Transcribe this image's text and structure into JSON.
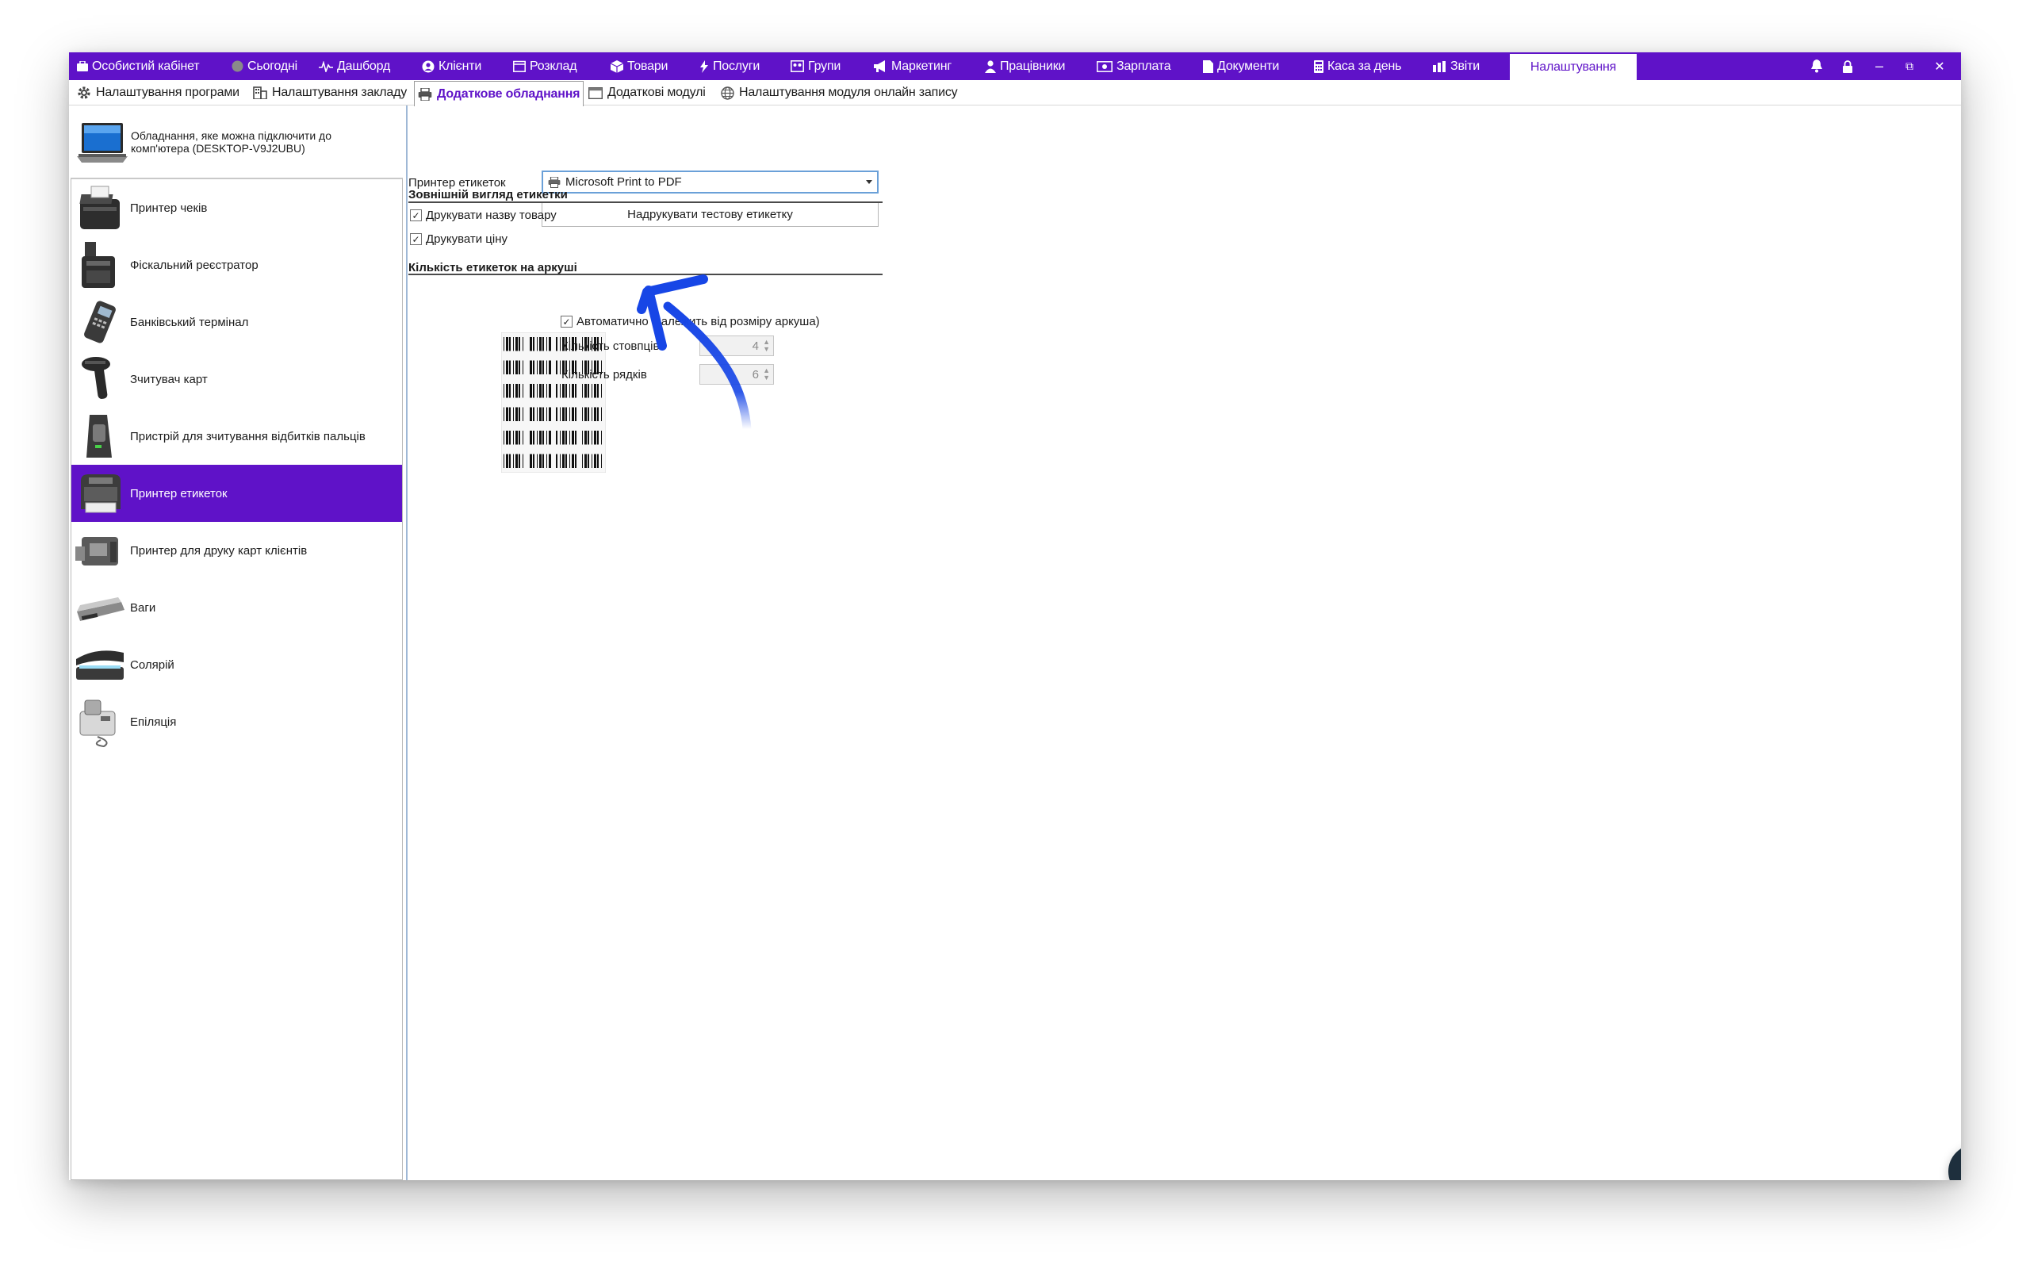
{
  "menu": {
    "items": [
      {
        "label": "Особистий кабінет",
        "icon": "briefcase-icon"
      },
      {
        "label": "Сьогодні",
        "icon": "clock-icon"
      },
      {
        "label": "Дашборд",
        "icon": "pulse-icon"
      },
      {
        "label": "Клієнти",
        "icon": "user-circle-icon"
      },
      {
        "label": "Розклад",
        "icon": "calendar-icon"
      },
      {
        "label": "Товари",
        "icon": "box-icon"
      },
      {
        "label": "Послуги",
        "icon": "lightning-icon"
      },
      {
        "label": "Групи",
        "icon": "group-icon"
      },
      {
        "label": "Маркетинг",
        "icon": "megaphone-icon"
      },
      {
        "label": "Працівники",
        "icon": "person-icon"
      },
      {
        "label": "Зарплата",
        "icon": "money-icon"
      },
      {
        "label": "Документи",
        "icon": "document-icon"
      },
      {
        "label": "Каса за день",
        "icon": "calculator-icon"
      },
      {
        "label": "Звіти",
        "icon": "bar-chart-icon"
      }
    ],
    "active": "Налаштування"
  },
  "window_buttons": {
    "bell": "bell-icon",
    "lock": "lock-icon",
    "minimize": "–",
    "restore": "⧉",
    "close": "✕"
  },
  "subtabs": [
    {
      "label": "Налаштування програми",
      "icon": "gear-icon"
    },
    {
      "label": "Налаштування закладу",
      "icon": "building-icon"
    },
    {
      "label": "Додаткове обладнання",
      "icon": "printer-icon",
      "active": true
    },
    {
      "label": "Додаткові модулі",
      "icon": "window-icon"
    },
    {
      "label": "Налаштування модуля онлайн запису",
      "icon": "globe-icon"
    }
  ],
  "device_header": "Обладнання, яке можна підключити до комп'ютера (DESKTOP-V9J2UBU)",
  "devices": [
    {
      "label": "Принтер чеків",
      "icon": "receipt-printer-icon"
    },
    {
      "label": "Фіскальний реєстратор",
      "icon": "fiscal-register-icon"
    },
    {
      "label": "Банківський термінал",
      "icon": "bank-terminal-icon"
    },
    {
      "label": "Зчитувач карт",
      "icon": "card-reader-icon"
    },
    {
      "label": "Пристрій для зчитування відбитків пальців",
      "icon": "fingerprint-reader-icon"
    },
    {
      "label": "Принтер етикеток",
      "icon": "label-printer-icon",
      "selected": true
    },
    {
      "label": "Принтер для друку карт клієнтів",
      "icon": "card-printer-icon"
    },
    {
      "label": "Ваги",
      "icon": "scales-icon"
    },
    {
      "label": "Солярій",
      "icon": "solarium-icon"
    },
    {
      "label": "Епіляція",
      "icon": "epilation-icon"
    }
  ],
  "settings": {
    "printer_label": "Принтер етикеток",
    "printer_value": "Microsoft Print to PDF",
    "test_button": "Надрукувати тестову етикетку",
    "appearance_title": "Зовнішній вигляд етикетки",
    "print_name": {
      "label": "Друкувати назву товару",
      "checked": true
    },
    "print_price": {
      "label": "Друкувати ціну",
      "checked": true
    },
    "count_title": "Кількість етикеток на аркуші",
    "auto": {
      "label": "Автоматично (залежить від розміру аркуша)",
      "checked": true
    },
    "columns_label": "Кількість стовпців",
    "columns_value": "4",
    "rows_label": "Кількість рядків",
    "rows_value": "6"
  },
  "colors": {
    "accent": "#5f12c8",
    "annotation_arrow": "#1746e6",
    "chat_button": "#1e2f3d"
  }
}
